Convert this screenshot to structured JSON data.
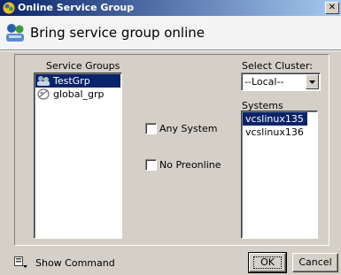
{
  "window": {
    "title": "Online Service Group",
    "close_glyph": "✕",
    "icon": "service-group-icon"
  },
  "header": {
    "title": "Bring service group online",
    "icon": "service-group-icon"
  },
  "service_groups": {
    "label": "Service Groups",
    "items": [
      {
        "label": "TestGrp",
        "icon": "service-group-icon",
        "selected": true
      },
      {
        "label": "global_grp",
        "icon": "global-group-icon",
        "selected": false
      }
    ]
  },
  "options": {
    "any_system": {
      "label": "Any System",
      "checked": false
    },
    "no_preonline": {
      "label": "No Preonline",
      "checked": false
    }
  },
  "cluster": {
    "label": "Select Cluster:",
    "value": "--Local--"
  },
  "systems": {
    "label": "Systems",
    "items": [
      {
        "label": "vcslinux135",
        "selected": true
      },
      {
        "label": "vcslinux136",
        "selected": false
      }
    ]
  },
  "footer": {
    "show_command_label": "Show Command",
    "ok_label": "OK",
    "cancel_label": "Cancel"
  },
  "colors": {
    "selection": "#0a246a",
    "title_gradient_start": "#0a246a",
    "title_gradient_end": "#a6caf0",
    "dialog_face": "#d4d0c8"
  }
}
